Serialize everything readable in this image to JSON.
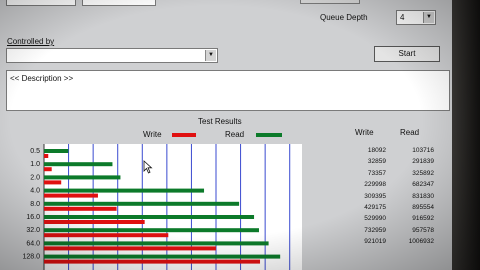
{
  "top": {
    "queue_depth_label": "Queue Depth",
    "queue_depth_value": "4"
  },
  "controlled_by": {
    "label": "Controlled by",
    "value": "",
    "start_label": "Start"
  },
  "description": {
    "text": "<< Description >>"
  },
  "results": {
    "title": "Test Results",
    "legend_write": "Write",
    "legend_read": "Read",
    "col_write": "Write",
    "col_read": "Read",
    "colors": {
      "write": "#e01010",
      "read": "#0c7a2a",
      "grid": "#3a4ad0"
    }
  },
  "chart_data": {
    "type": "bar",
    "orientation": "horizontal",
    "title": "Test Results",
    "categories": [
      "0.5",
      "1.0",
      "2.0",
      "4.0",
      "8.0",
      "16.0",
      "32.0",
      "64.0",
      "128.0"
    ],
    "series": [
      {
        "name": "Write",
        "values": [
          18092,
          32859,
          73357,
          229998,
          309395,
          429175,
          529990,
          732959,
          921019
        ]
      },
      {
        "name": "Read",
        "values": [
          103716,
          291839,
          325892,
          682347,
          831830,
          895554,
          916592,
          957578,
          1006932
        ]
      }
    ],
    "write_labels": [
      "18092",
      "32859",
      "73357",
      "229998",
      "309395",
      "429175",
      "529990",
      "732959",
      "921019"
    ],
    "read_labels": [
      "103716",
      "291839",
      "325892",
      "682347",
      "831830",
      "895554",
      "916592",
      "957578",
      "1006932"
    ],
    "xlim": [
      0,
      1100000
    ],
    "grid": true
  }
}
